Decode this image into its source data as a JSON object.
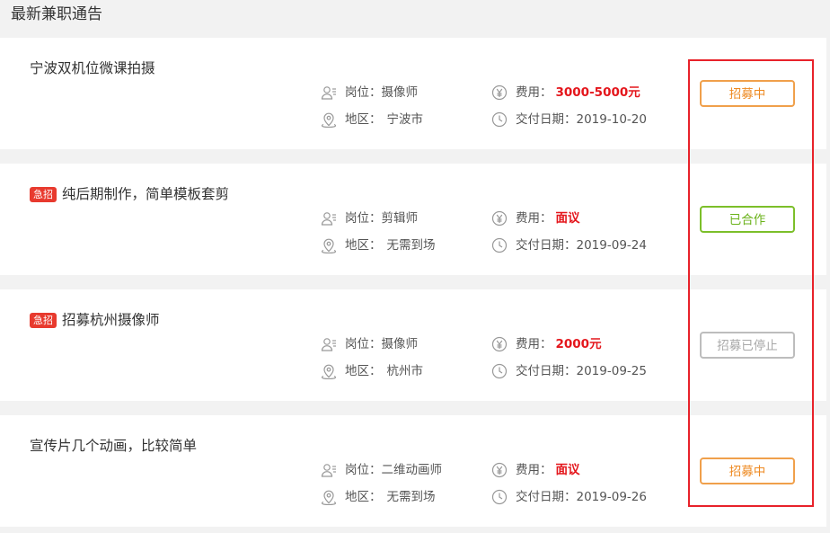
{
  "section_title": "最新兼职通告",
  "labels": {
    "role": "岗位：",
    "area": "地区：",
    "fee": "费用：",
    "date": "交付日期："
  },
  "jobs": [
    {
      "title": "宁波双机位微课拍摄",
      "urgent_badge": "",
      "role": "摄像师",
      "area": "宁波市",
      "fee": "3000-5000元",
      "date": "2019-10-20",
      "status": "招募中",
      "status_kind": "recruiting"
    },
    {
      "title": "纯后期制作，简单模板套剪",
      "urgent_badge": "急招",
      "role": "剪辑师",
      "area": "无需到场",
      "fee": "面议",
      "date": "2019-09-24",
      "status": "已合作",
      "status_kind": "cooperated"
    },
    {
      "title": "招募杭州摄像师",
      "urgent_badge": "急招",
      "role": "摄像师",
      "area": "杭州市",
      "fee": "2000元",
      "date": "2019-09-25",
      "status": "招募已停止",
      "status_kind": "stopped"
    },
    {
      "title": "宣传片几个动画，比较简单",
      "urgent_badge": "",
      "role": "二维动画师",
      "area": "无需到场",
      "fee": "面议",
      "date": "2019-09-26",
      "status": "招募中",
      "status_kind": "recruiting"
    }
  ],
  "colors": {
    "fee": "#e4161c",
    "urgent": "#e83a2e",
    "recruiting": "#ee8a22",
    "cooperated": "#6ab21a",
    "stopped": "#a8a8a8",
    "highlight": "#e8222a"
  }
}
